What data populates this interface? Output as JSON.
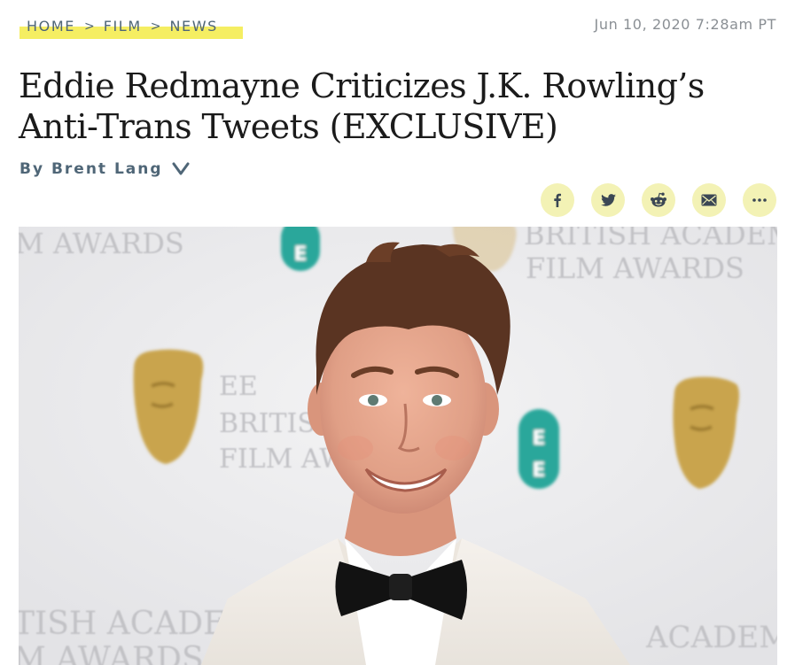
{
  "breadcrumb": {
    "items": [
      "HOME",
      "FILM",
      "NEWS"
    ],
    "separator": ">"
  },
  "date": "Jun 10, 2020 7:28am PT",
  "headline": "Eddie Redmayne Criticizes J.K. Rowling’s Anti-Trans Tweets (EXCLUSIVE)",
  "byline": {
    "label": "By Brent Lang"
  },
  "share": {
    "buttons": [
      "facebook-icon",
      "twitter-icon",
      "reddit-icon",
      "email-icon",
      "more-icon"
    ]
  },
  "photo": {
    "backdrop_text": [
      "M AWARDS",
      "BRITISH ACADEM",
      "FILM AWARDS",
      "EE",
      "BRITIS",
      "FILM AW",
      "TISH ACADE",
      "M AWARDS",
      "ACADEM"
    ],
    "description_icons": [
      "bafta-mask-icon",
      "ee-logo-icon"
    ]
  },
  "colors": {
    "highlight": "#f5ee62",
    "nav_text": "#4f6677",
    "date_text": "#8a8f94",
    "share_bg": "#f3f2b5",
    "ee_teal": "#2aa79b",
    "bafta_gold": "#c9a44d"
  }
}
